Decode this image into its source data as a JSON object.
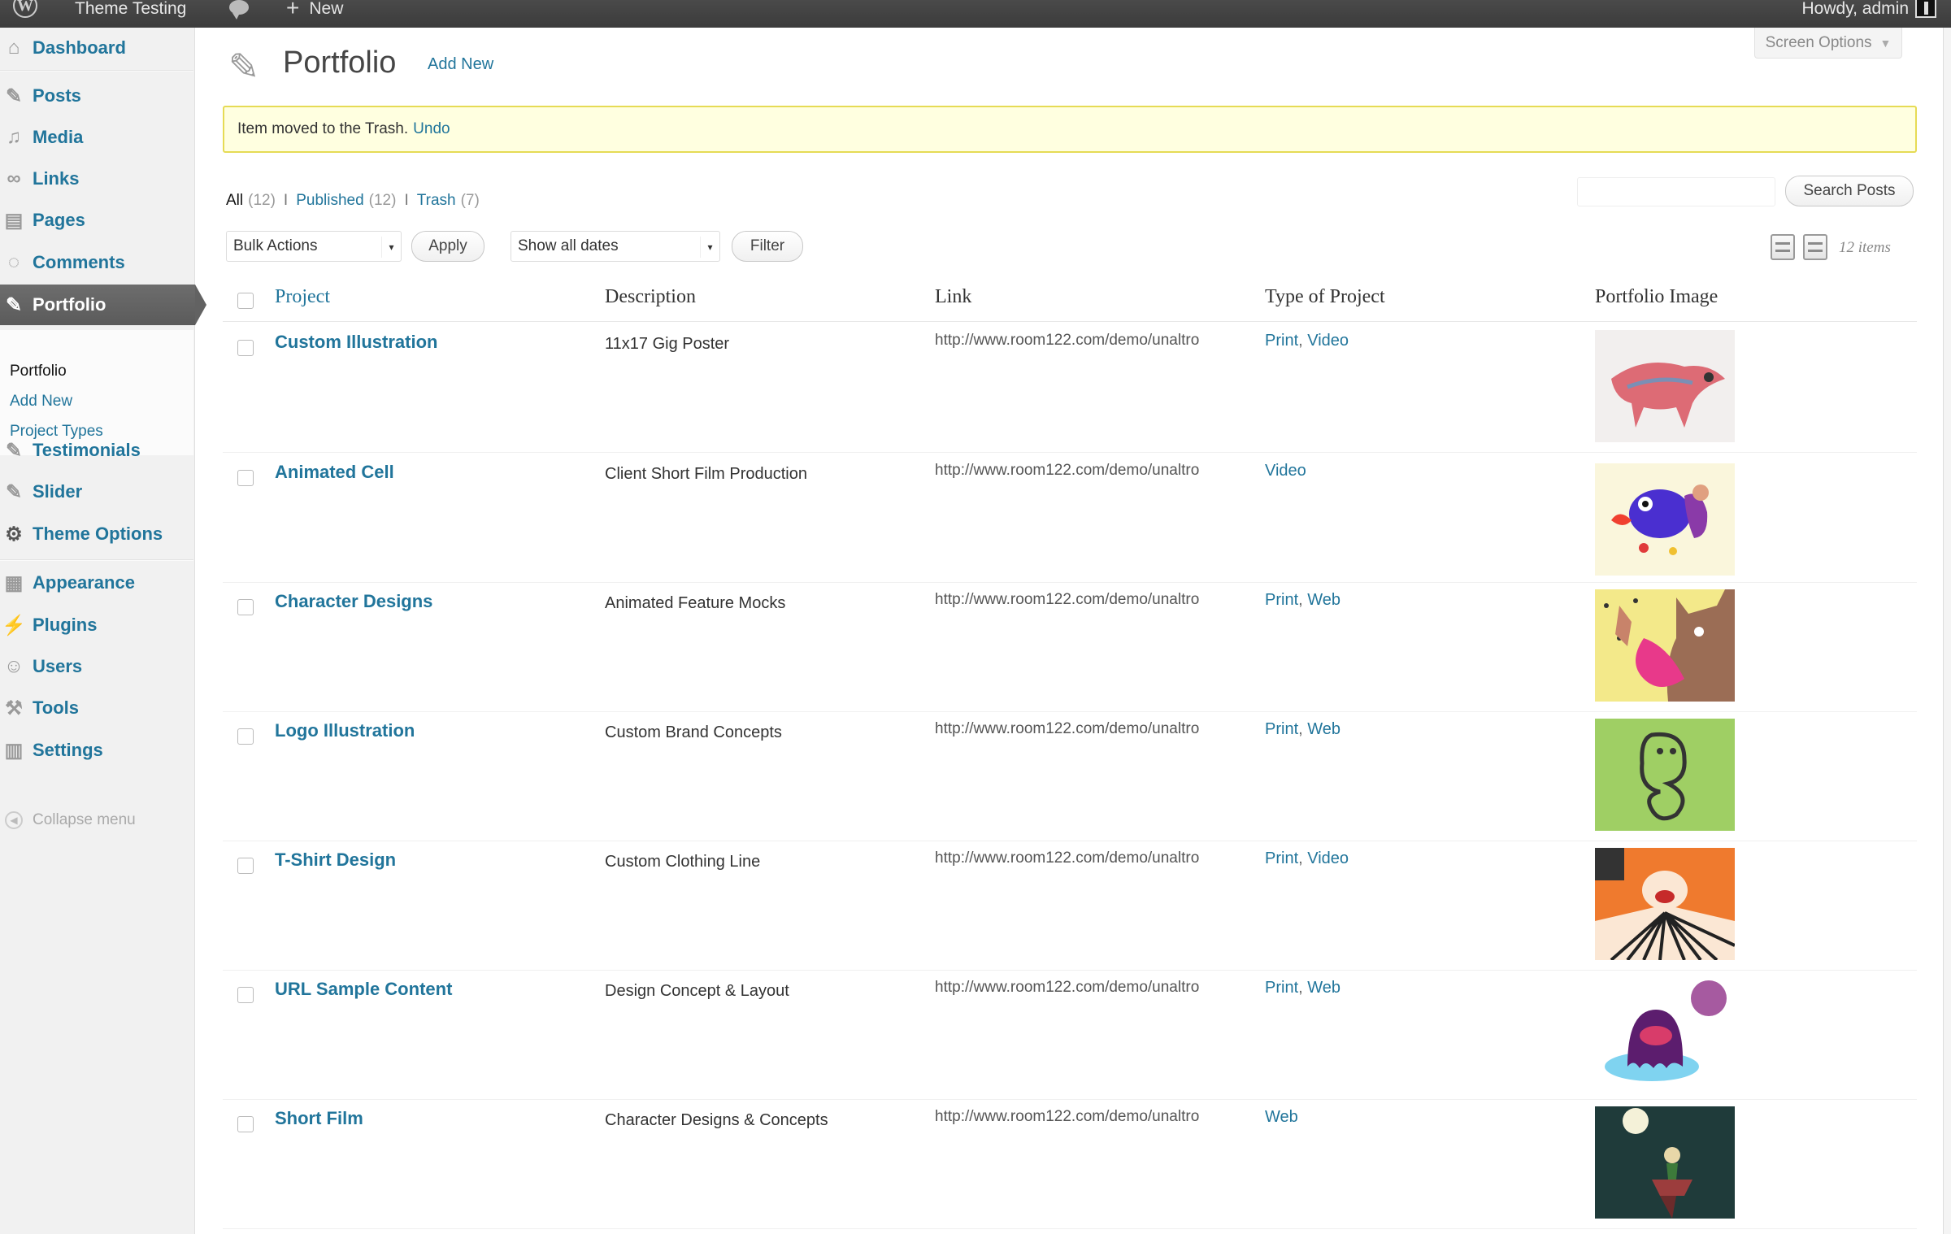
{
  "adminbar": {
    "site_name": "Theme Testing",
    "new_label": "New",
    "howdy": "Howdy, admin"
  },
  "sidebar": {
    "items": [
      {
        "label": "Dashboard",
        "icon": "dashboard-icon"
      },
      {
        "label": "Posts",
        "icon": "pushpin-icon"
      },
      {
        "label": "Media",
        "icon": "media-icon"
      },
      {
        "label": "Links",
        "icon": "link-icon"
      },
      {
        "label": "Pages",
        "icon": "pages-icon"
      },
      {
        "label": "Comments",
        "icon": "comment-icon"
      },
      {
        "label": "Portfolio",
        "icon": "pushpin-icon"
      },
      {
        "label": "Testimonials",
        "icon": "pushpin-icon"
      },
      {
        "label": "Slider",
        "icon": "pushpin-icon"
      },
      {
        "label": "Theme Options",
        "icon": "gear-icon"
      },
      {
        "label": "Appearance",
        "icon": "appearance-icon"
      },
      {
        "label": "Plugins",
        "icon": "plugin-icon"
      },
      {
        "label": "Users",
        "icon": "users-icon"
      },
      {
        "label": "Tools",
        "icon": "tools-icon"
      },
      {
        "label": "Settings",
        "icon": "settings-icon"
      }
    ],
    "submenu": [
      "Portfolio",
      "Add New",
      "Project Types"
    ],
    "collapse": "Collapse menu"
  },
  "screen_options": "Screen Options",
  "header": {
    "title": "Portfolio",
    "add_new": "Add New"
  },
  "notice": {
    "text": "Item moved to the Trash.",
    "undo": "Undo"
  },
  "filters": {
    "all": "All",
    "all_count": "(12)",
    "published": "Published",
    "published_count": "(12)",
    "trash": "Trash",
    "trash_count": "(7)",
    "separator": "I"
  },
  "search": {
    "value": "",
    "button": "Search Posts"
  },
  "toolbar": {
    "bulk_actions": "Bulk Actions",
    "apply": "Apply",
    "dates": "Show all dates",
    "filter": "Filter",
    "items_count": "12 items"
  },
  "table": {
    "columns": [
      "Project",
      "Description",
      "Link",
      "Type of Project",
      "Portfolio Image"
    ],
    "rows": [
      {
        "title": "Custom Illustration",
        "desc": "11x17 Gig Poster",
        "link": "http://www.room122.com/demo/unaltro",
        "types": [
          "Print",
          "Video"
        ]
      },
      {
        "title": "Animated Cell",
        "desc": "Client Short Film Production",
        "link": "http://www.room122.com/demo/unaltro",
        "types": [
          "Video"
        ]
      },
      {
        "title": "Character Designs",
        "desc": "Animated Feature Mocks",
        "link": "http://www.room122.com/demo/unaltro",
        "types": [
          "Print",
          "Web"
        ]
      },
      {
        "title": "Logo Illustration",
        "desc": "Custom Brand Concepts",
        "link": "http://www.room122.com/demo/unaltro",
        "types": [
          "Print",
          "Web"
        ]
      },
      {
        "title": "T-Shirt Design",
        "desc": "Custom Clothing Line",
        "link": "http://www.room122.com/demo/unaltro",
        "types": [
          "Print",
          "Video"
        ]
      },
      {
        "title": "URL Sample Content",
        "desc": "Design Concept & Layout",
        "link": "http://www.room122.com/demo/unaltro",
        "types": [
          "Print",
          "Web"
        ]
      },
      {
        "title": "Short Film",
        "desc": "Character Designs & Concepts",
        "link": "http://www.room122.com/demo/unaltro",
        "types": [
          "Web"
        ]
      }
    ]
  }
}
